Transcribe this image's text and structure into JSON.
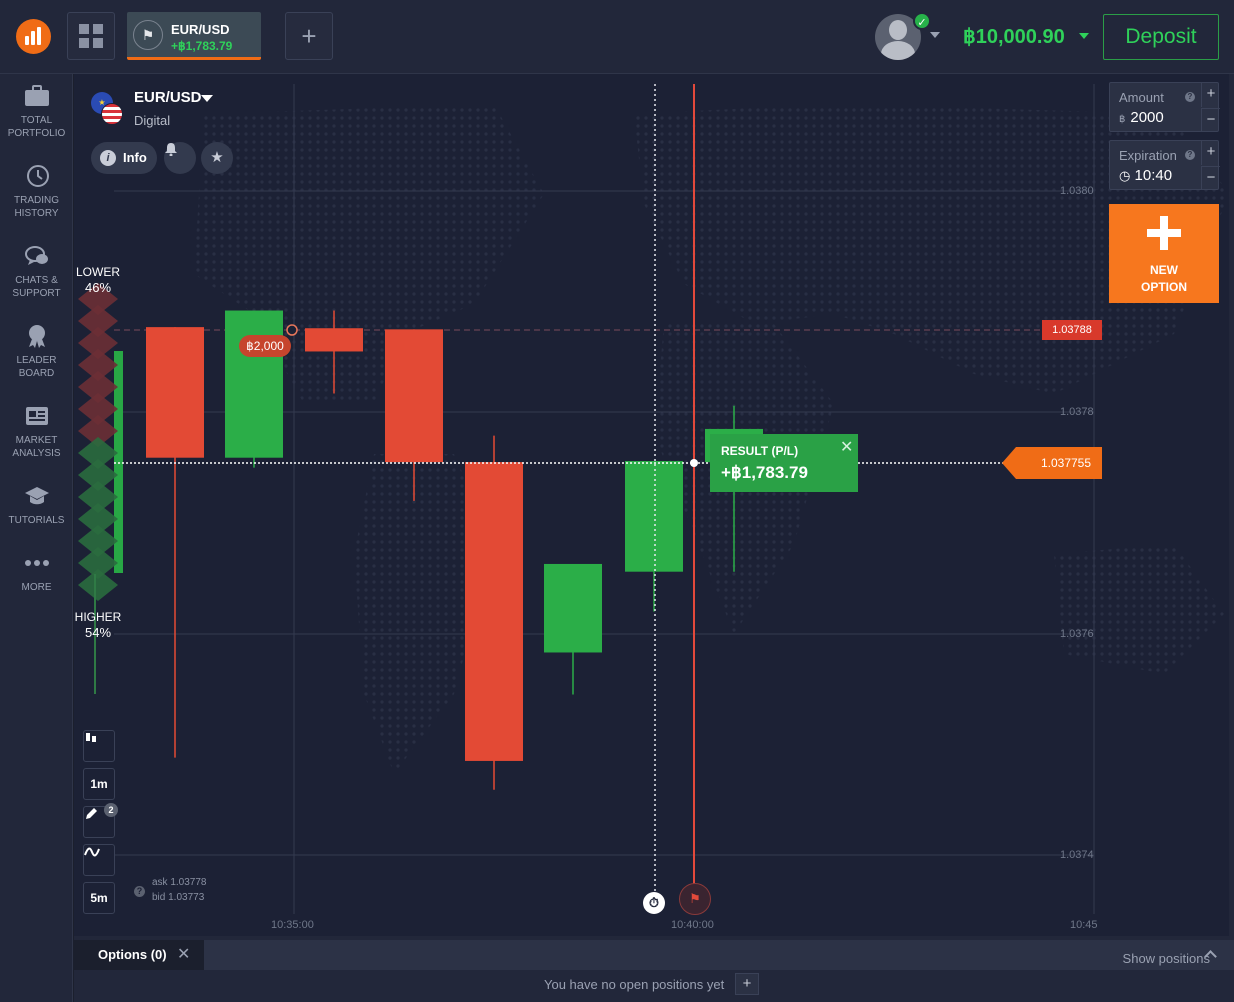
{
  "topbar": {
    "asset_tab": {
      "name": "EUR/USD",
      "pl": "+฿1,783.79"
    },
    "balance": "฿10,000.90",
    "deposit_label": "Deposit"
  },
  "sidebar": {
    "items": [
      {
        "label": "TOTAL\nPORTFOLIO",
        "icon": "briefcase-icon"
      },
      {
        "label": "TRADING\nHISTORY",
        "icon": "history-icon"
      },
      {
        "label": "CHATS &\nSUPPORT",
        "icon": "chat-icon"
      },
      {
        "label": "LEADER\nBOARD",
        "icon": "trophy-icon"
      },
      {
        "label": "MARKET\nANALYSIS",
        "icon": "newspaper-icon"
      },
      {
        "label": "TUTORIALS",
        "icon": "graduation-cap-icon"
      },
      {
        "label": "MORE",
        "icon": "more-dots-icon"
      }
    ]
  },
  "chart_header": {
    "pair": "EUR/USD",
    "type": "Digital",
    "info_label": "Info"
  },
  "sentiment": {
    "lower_label": "LOWER",
    "lower_pct": "46%",
    "higher_label": "HIGHER",
    "higher_pct": "54%"
  },
  "chart_data": {
    "type": "candlestick",
    "y_ticks": [
      "1.0380",
      "1.0378",
      "1.0376",
      "1.0374"
    ],
    "x_ticks": [
      "10:35:00",
      "10:40:00",
      "10:45"
    ],
    "candles": [
      {
        "open": 1.037759,
        "high": 1.037759,
        "low": 1.037488,
        "close": 1.037877,
        "dir": "down"
      },
      {
        "open": 1.037759,
        "high": 1.037892,
        "low": 1.03775,
        "close": 1.037892,
        "dir": "up"
      },
      {
        "open": 1.037855,
        "high": 1.037892,
        "low": 1.037817,
        "close": 1.037876,
        "dir": "down"
      },
      {
        "open": 1.037875,
        "high": 1.037875,
        "low": 1.03772,
        "close": 1.037755,
        "dir": "down"
      },
      {
        "open": 1.037755,
        "high": 1.037779,
        "low": 1.037459,
        "close": 1.037485,
        "dir": "down"
      },
      {
        "open": 1.037583,
        "high": 1.037663,
        "low": 1.037545,
        "close": 1.037663,
        "dir": "up"
      },
      {
        "open": 1.037656,
        "high": 1.037756,
        "low": 1.03762,
        "close": 1.037756,
        "dir": "up"
      },
      {
        "open": 1.037755,
        "high": 1.037806,
        "low": 1.037656,
        "close": 1.037785,
        "dir": "up"
      }
    ],
    "strike_price": "1.03788",
    "current_price": "1.037755",
    "bet_amount": "฿2,000",
    "ask": "ask 1.03778",
    "bid": "bid 1.03773"
  },
  "result": {
    "label": "RESULT (P/L)",
    "value": "+฿1,783.79"
  },
  "tools": [
    {
      "name": "candle-type-tool",
      "label": ""
    },
    {
      "name": "timeframe-1m",
      "label": "1m"
    },
    {
      "name": "draw-tool",
      "label": "",
      "badge": "2"
    },
    {
      "name": "indicator-tool",
      "label": ""
    },
    {
      "name": "timeframe-5m",
      "label": "5m"
    }
  ],
  "trade_panel": {
    "amount_label": "Amount",
    "amount_currency": "฿",
    "amount_value": "2000",
    "expiration_label": "Expiration",
    "expiration_value": "10:40",
    "new_option_label": "NEW\nOPTION"
  },
  "bottom": {
    "tab_label": "Options (0)",
    "show_positions": "Show positions",
    "no_positions": "You have no open positions yet"
  }
}
